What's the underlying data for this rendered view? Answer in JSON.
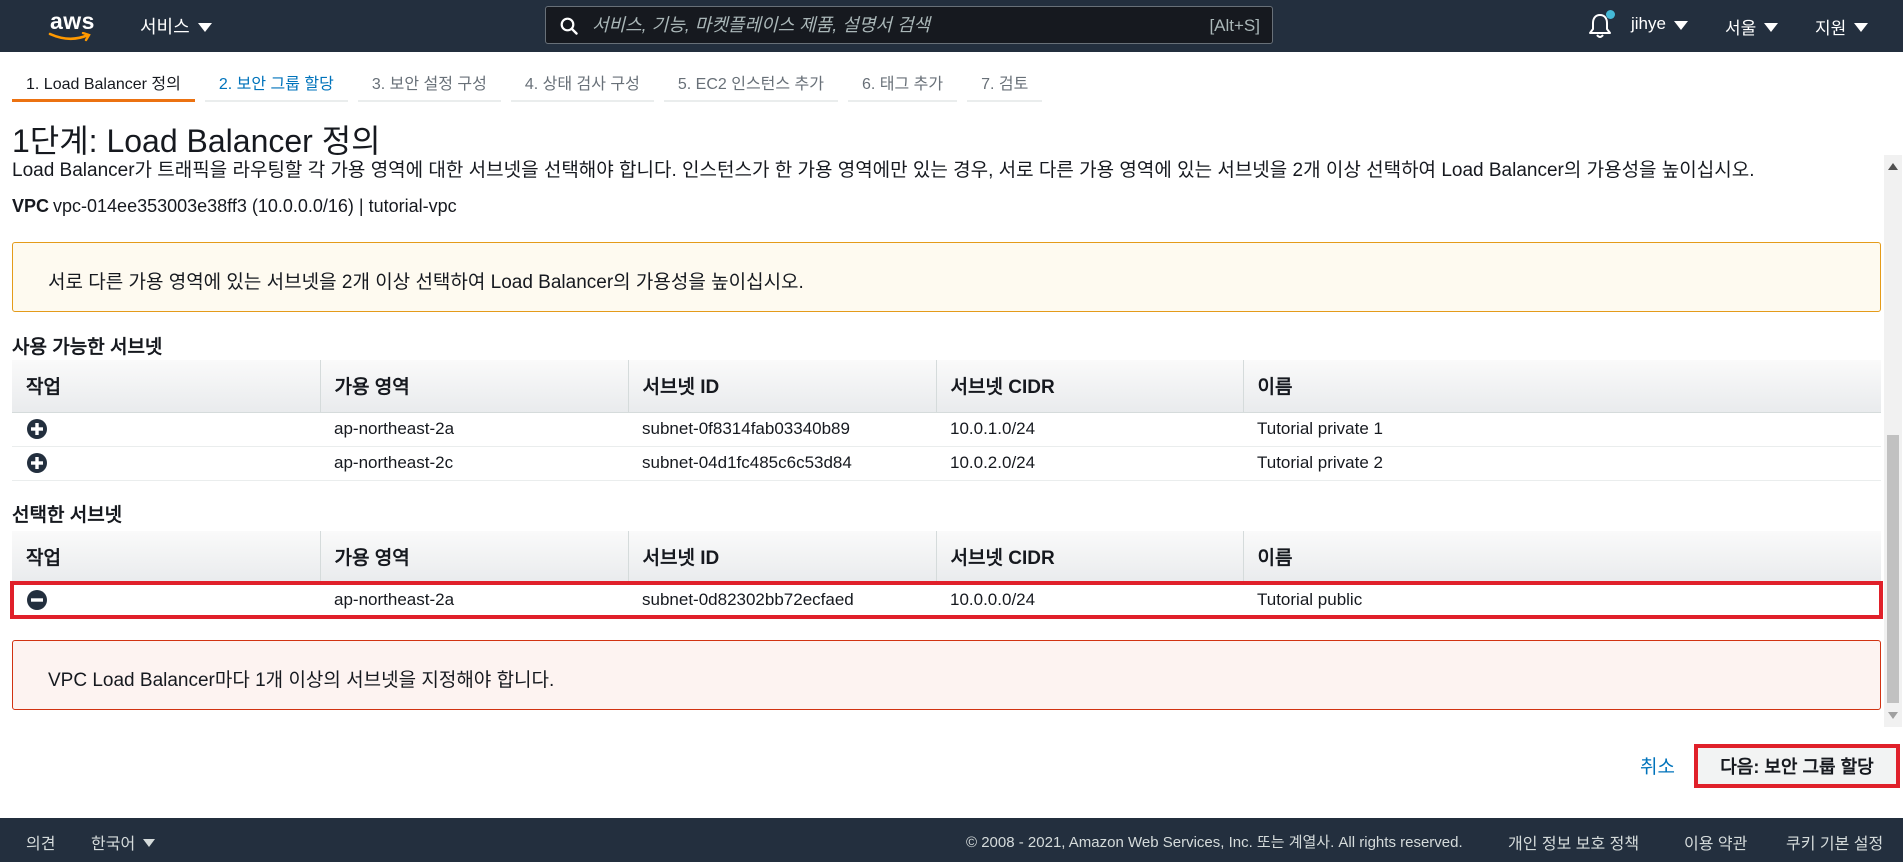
{
  "topnav": {
    "logo_text": "aws",
    "services_label": "서비스",
    "search_placeholder": "서비스, 기능, 마켓플레이스 제품, 설명서 검색",
    "search_shortcut": "[Alt+S]",
    "user_label": "jihye",
    "region_label": "서울",
    "support_label": "지원",
    "notification_dot_color": "#44b9d6"
  },
  "wizard": {
    "steps": [
      {
        "label": "1. Load Balancer 정의"
      },
      {
        "label": "2. 보안 그룹 할당"
      },
      {
        "label": "3. 보안 설정 구성"
      },
      {
        "label": "4. 상태 검사 구성"
      },
      {
        "label": "5. EC2 인스턴스 추가"
      },
      {
        "label": "6. 태그 추가"
      },
      {
        "label": "7. 검토"
      }
    ],
    "active_color": "#ec7211"
  },
  "page": {
    "title": "1단계: Load Balancer 정의",
    "description": "Load Balancer가 트래픽을 라우팅할 각 가용 영역에 대한 서브넷을 선택해야 합니다. 인스턴스가 한 가용 영역에만 있는 경우, 서로 다른 가용 영역에 있는 서브넷을 2개 이상 선택하여 Load Balancer의 가용성을 높이십시오.",
    "vpc_label": "VPC",
    "vpc_value": "vpc-014ee353003e38ff3 (10.0.0.0/16) | tutorial-vpc",
    "info_alert": "서로 다른 가용 영역에 있는 서브넷을 2개 이상 선택하여 Load Balancer의 가용성을 높이십시오.",
    "error_alert": "VPC Load Balancer마다 1개 이상의 서브넷을 지정해야 합니다."
  },
  "available_subnets": {
    "title": "사용 가능한 서브넷",
    "columns": [
      "작업",
      "가용 영역",
      "서브넷 ID",
      "서브넷 CIDR",
      "이름"
    ],
    "rows": [
      {
        "action_icon": "add-circle-icon",
        "az": "ap-northeast-2a",
        "subnet_id": "subnet-0f8314fab03340b89",
        "cidr": "10.0.1.0/24",
        "name": "Tutorial private 1"
      },
      {
        "action_icon": "add-circle-icon",
        "az": "ap-northeast-2c",
        "subnet_id": "subnet-04d1fc485c6c53d84",
        "cidr": "10.0.2.0/24",
        "name": "Tutorial private 2"
      }
    ]
  },
  "selected_subnets": {
    "title": "선택한 서브넷",
    "columns": [
      "작업",
      "가용 영역",
      "서브넷 ID",
      "서브넷 CIDR",
      "이름"
    ],
    "rows": [
      {
        "action_icon": "remove-circle-icon",
        "az": "ap-northeast-2a",
        "subnet_id": "subnet-0d82302bb72ecfaed",
        "cidr": "10.0.0.0/24",
        "name": "Tutorial public"
      }
    ]
  },
  "actions": {
    "cancel_label": "취소",
    "next_label": "다음: 보안 그룹 할당",
    "highlight_color": "#e0202a"
  },
  "footer": {
    "feedback_label": "의견",
    "language_label": "한국어",
    "copyright": "© 2008 - 2021, Amazon Web Services, Inc. 또는 계열사. All rights reserved.",
    "privacy_label": "개인 정보 보호 정책",
    "terms_label": "이용 약관",
    "cookie_label": "쿠키 기본 설정"
  }
}
